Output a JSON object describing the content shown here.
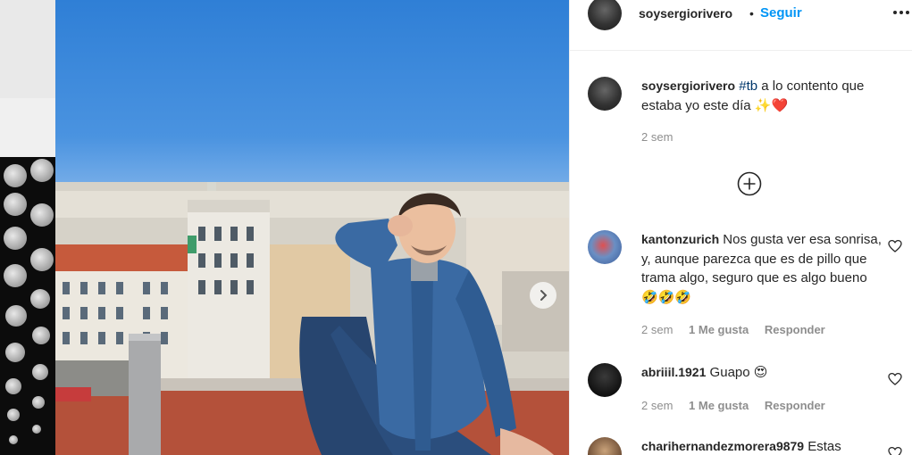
{
  "post": {
    "author": "soysergiorivero",
    "separator": "•",
    "follow_label": "Seguir",
    "caption": {
      "username": "soysergiorivero",
      "hashtag": "#tb",
      "text": " a lo contento que estaba yo este día ",
      "emoji": "✨❤️",
      "time": "2 sem"
    }
  },
  "comments": [
    {
      "username": "kantonzurich",
      "text": " Nos gusta ver esa sonrisa, y, aunque parezca que es de pillo que trama algo, seguro que es algo bueno ",
      "emoji": "🤣🤣🤣",
      "time": "2 sem",
      "likes_label": "1 Me gusta",
      "reply_label": "Responder"
    },
    {
      "username": "abriiil.1921",
      "text": " Guapo ",
      "emoji": "😍",
      "time": "2 sem",
      "likes_label": "1 Me gusta",
      "reply_label": "Responder"
    },
    {
      "username": "charihernandezmorera9879",
      "text": " Estas"
    }
  ],
  "icons": {
    "more": "more-horizontal-icon",
    "load_more": "plus-circle-icon",
    "like": "heart-outline-icon",
    "next": "chevron-right-icon"
  },
  "colors": {
    "link": "#0095f6",
    "hashtag": "#00376b",
    "muted": "#8e8e8e",
    "text": "#262626"
  }
}
